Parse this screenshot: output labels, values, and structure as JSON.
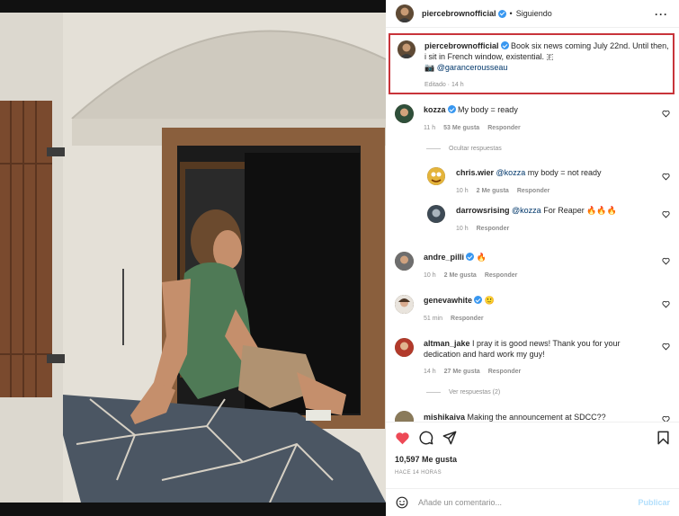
{
  "post": {
    "author": "piercebrownofficial",
    "separator": "•",
    "follow_label": "Siguiendo",
    "more_label": "···"
  },
  "caption": {
    "author": "piercebrownofficial",
    "text": "Book six news coming July 22nd. Until then, i sit in French window, existential. 🇫",
    "line2_prefix": "📷",
    "mention": "@garancerousseau",
    "meta": "Editado · 14 h"
  },
  "comments": [
    {
      "user": "kozza",
      "verified": true,
      "text": "My body = ready",
      "time": "11 h",
      "likes": "53 Me gusta",
      "reply": "Responder"
    },
    {
      "user": "andre_pilli",
      "verified": true,
      "text": "🔥",
      "time": "10 h",
      "likes": "2 Me gusta",
      "reply": "Responder"
    },
    {
      "user": "genevawhite",
      "verified": true,
      "text": "🙂",
      "time": "51 min",
      "likes": "",
      "reply": "Responder"
    },
    {
      "user": "altman_jake",
      "verified": false,
      "text": "I pray it is good news! Thank you for your dedication and hard work my guy!",
      "time": "14 h",
      "likes": "27 Me gusta",
      "reply": "Responder"
    },
    {
      "user": "mishikaiva",
      "verified": false,
      "text": "Making the announcement at SDCC??"
    }
  ],
  "replies_toggle": {
    "hide": "Ocultar respuestas",
    "show": "Ver respuestas (2)"
  },
  "replies": [
    {
      "user": "chris.wier",
      "mention": "@kozza",
      "text": "my body = not ready",
      "time": "10 h",
      "likes": "2 Me gusta",
      "reply": "Responder"
    },
    {
      "user": "darrowsrising",
      "mention": "@kozza",
      "text": "For Reaper 🔥🔥🔥",
      "time": "10 h",
      "likes": "",
      "reply": "Responder"
    }
  ],
  "footer": {
    "likes": "10,597 Me gusta",
    "ago": "HACE 14 HORAS",
    "comment_placeholder": "Añade un comentario...",
    "publish_label": "Publicar"
  },
  "colors": {
    "like_red": "#ed4956",
    "link_blue": "#00376b",
    "verified_blue": "#3897f0",
    "highlight_border": "#c8343a"
  },
  "icons": [
    "more-icon",
    "verified-icon",
    "heart-icon",
    "comment-icon",
    "share-icon",
    "bookmark-icon",
    "emoji-icon"
  ]
}
